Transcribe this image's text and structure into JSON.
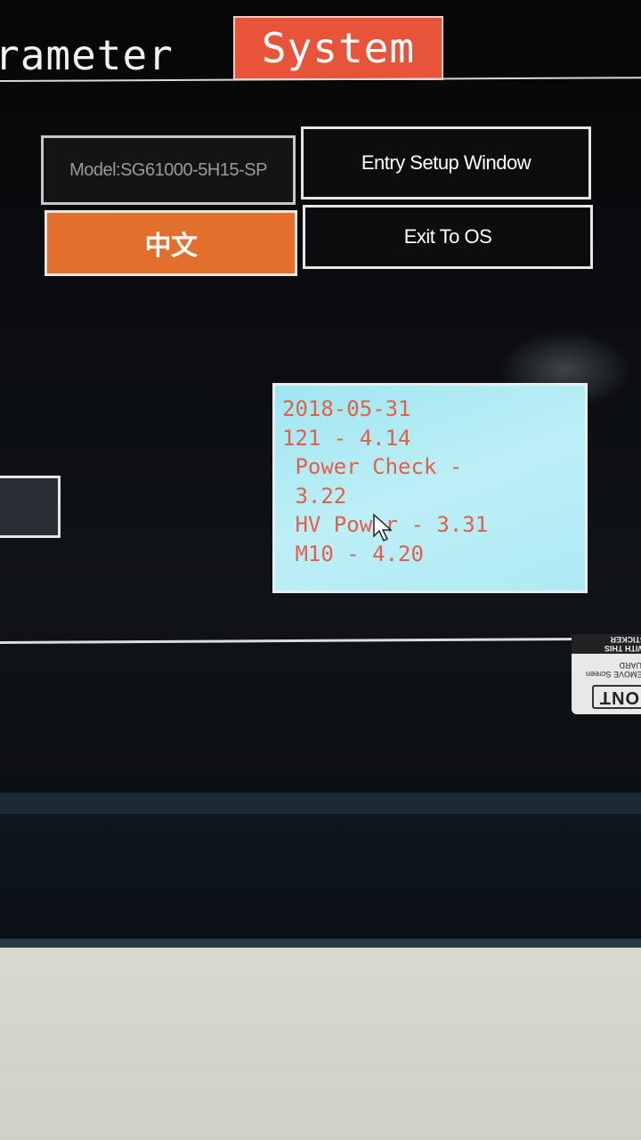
{
  "tabs": {
    "parameter_label": "rameter",
    "system_label": "System"
  },
  "system_panel": {
    "model_label": "Model:SG61000-5H15-SP",
    "entry_setup_label": "Entry Setup Window",
    "language_label": "中文",
    "exit_label": "Exit To OS"
  },
  "version_info": {
    "lines": [
      "2018-05-31",
      "121 - 4.14",
      " Power Check -",
      " 3.22",
      " HV Power - 3.31",
      " M10 - 4.20"
    ]
  },
  "sticker": {
    "line1": "ONT",
    "line2": "REMOVE Screen GUARD",
    "line3": "WITH THIS STICKER"
  },
  "colors": {
    "accent_tab": "#e8543a",
    "language_button": "#e26f2c",
    "info_panel": "#b3ecf5",
    "info_text": "#e0604a"
  }
}
